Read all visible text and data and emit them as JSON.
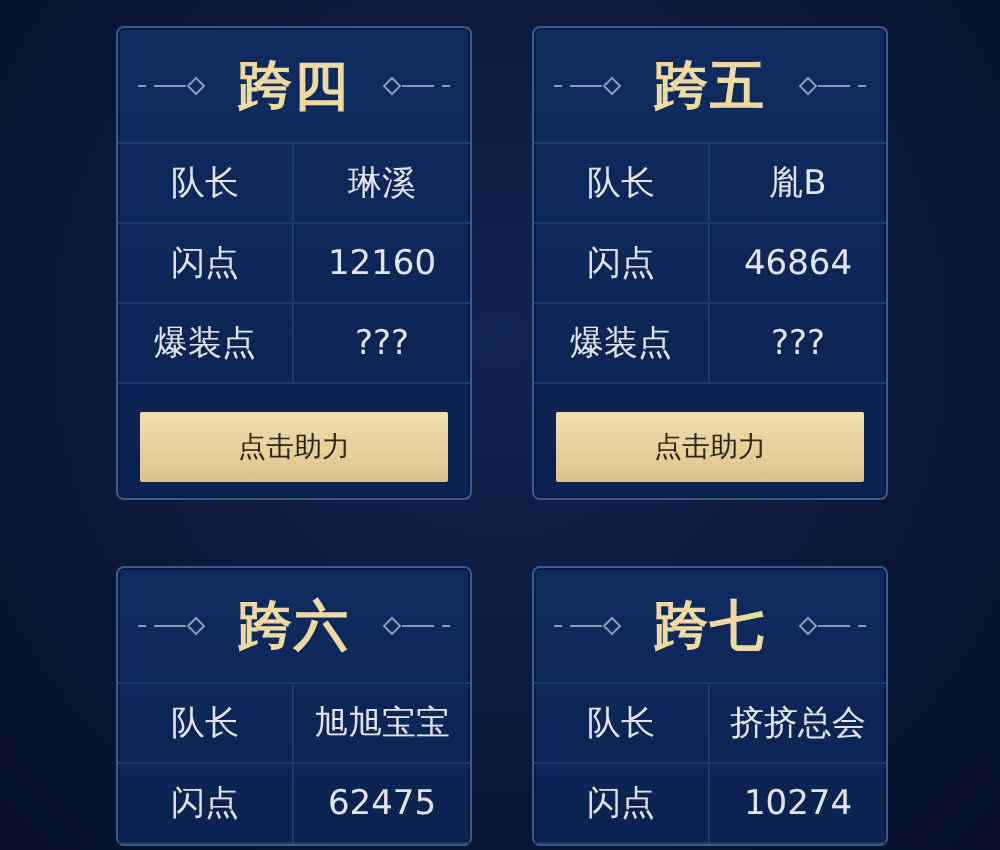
{
  "teams": [
    {
      "title": "跨四",
      "rows": [
        {
          "label": "队长",
          "value": "琳溪"
        },
        {
          "label": "闪点",
          "value": "12160"
        },
        {
          "label": "爆装点",
          "value": "???"
        }
      ],
      "button": "点击助力"
    },
    {
      "title": "跨五",
      "rows": [
        {
          "label": "队长",
          "value": "胤B"
        },
        {
          "label": "闪点",
          "value": "46864"
        },
        {
          "label": "爆装点",
          "value": "???"
        }
      ],
      "button": "点击助力"
    },
    {
      "title": "跨六",
      "rows": [
        {
          "label": "队长",
          "value": "旭旭宝宝"
        },
        {
          "label": "闪点",
          "value": "62475"
        }
      ]
    },
    {
      "title": "跨七",
      "rows": [
        {
          "label": "队长",
          "value": "挤挤总会"
        },
        {
          "label": "闪点",
          "value": "10274"
        }
      ]
    }
  ]
}
